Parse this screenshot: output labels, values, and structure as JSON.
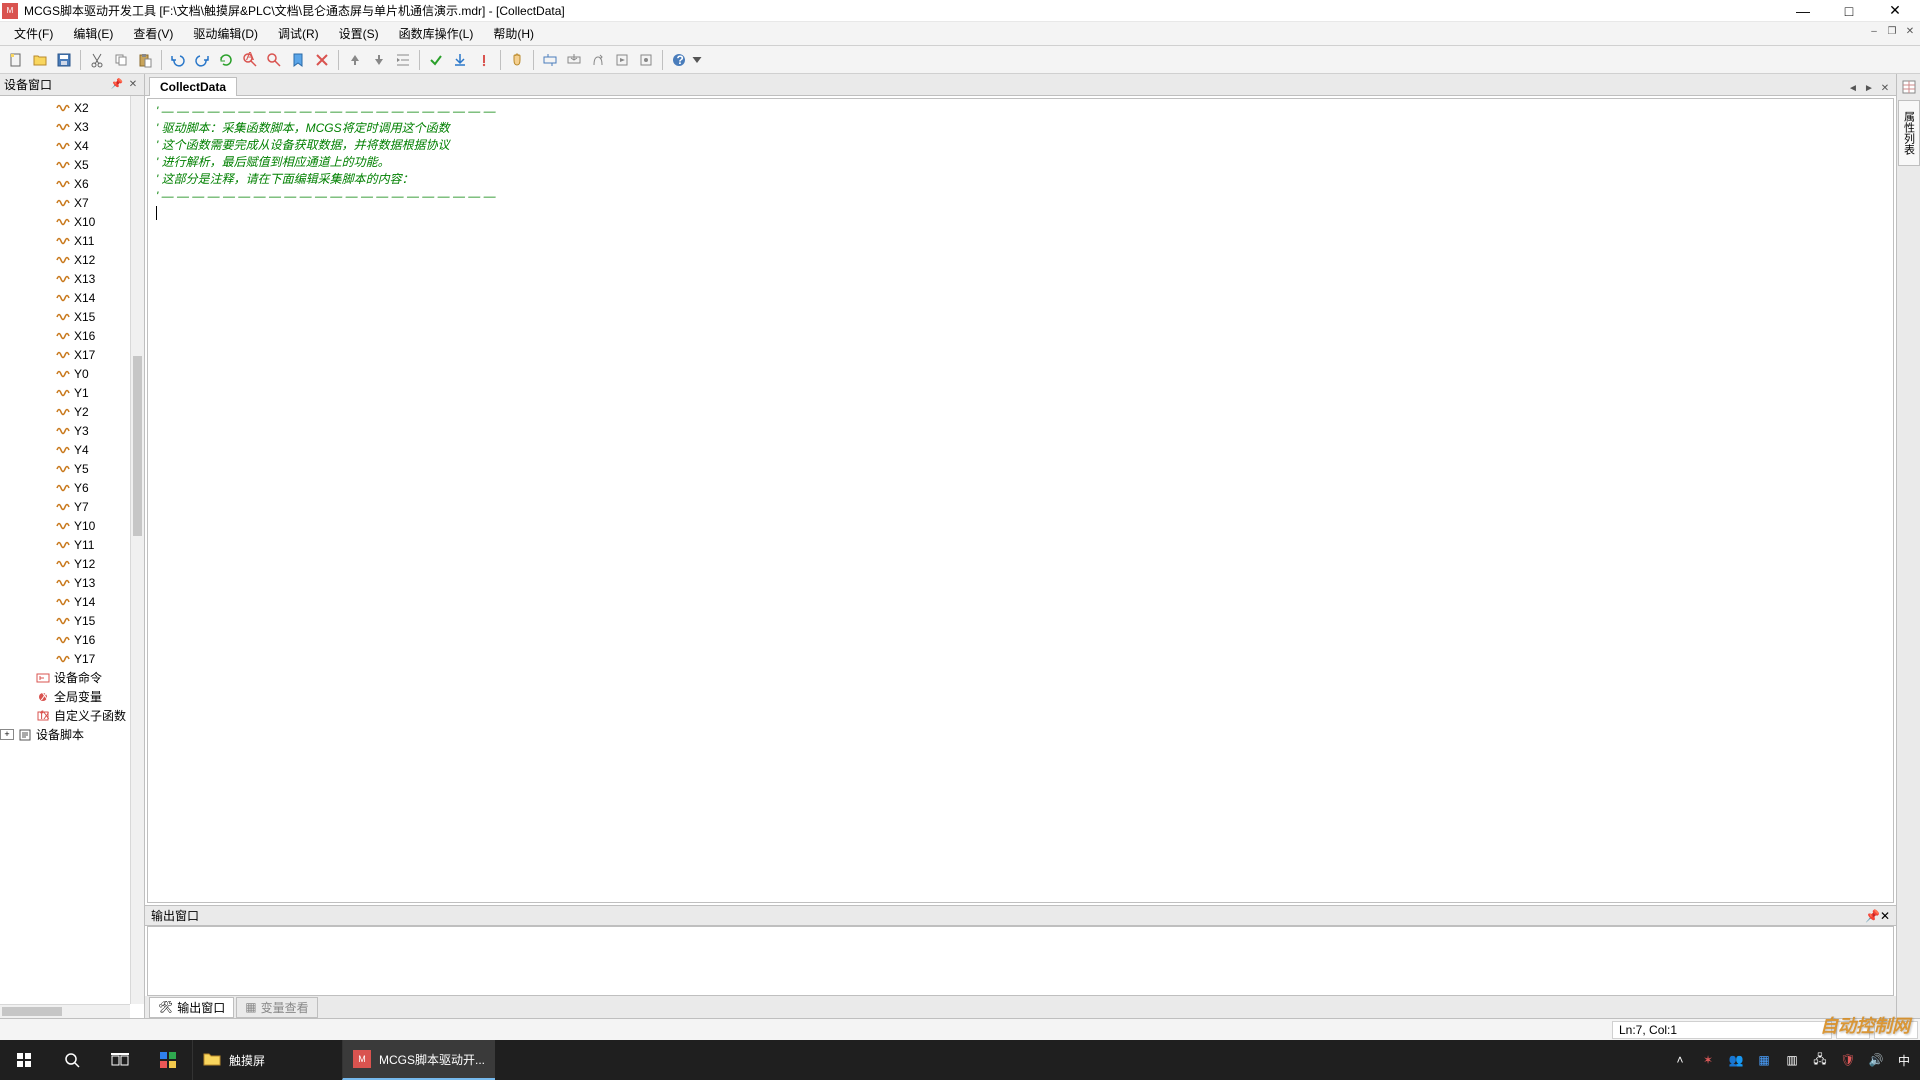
{
  "window": {
    "title": "MCGS脚本驱动开发工具 [F:\\文档\\触摸屏&PLC\\文档\\昆仑通态屏与单片机通信演示.mdr] - [CollectData]"
  },
  "menu": {
    "items": [
      "文件(F)",
      "编辑(E)",
      "查看(V)",
      "驱动编辑(D)",
      "调试(R)",
      "设置(S)",
      "函数库操作(L)",
      "帮助(H)"
    ]
  },
  "left_panel": {
    "title": "设备窗口",
    "nodes": [
      {
        "label": "X2",
        "icon": "s"
      },
      {
        "label": "X3",
        "icon": "s"
      },
      {
        "label": "X4",
        "icon": "s"
      },
      {
        "label": "X5",
        "icon": "s"
      },
      {
        "label": "X6",
        "icon": "s"
      },
      {
        "label": "X7",
        "icon": "s"
      },
      {
        "label": "X10",
        "icon": "s"
      },
      {
        "label": "X11",
        "icon": "s"
      },
      {
        "label": "X12",
        "icon": "s"
      },
      {
        "label": "X13",
        "icon": "s"
      },
      {
        "label": "X14",
        "icon": "s"
      },
      {
        "label": "X15",
        "icon": "s"
      },
      {
        "label": "X16",
        "icon": "s"
      },
      {
        "label": "X17",
        "icon": "s"
      },
      {
        "label": "Y0",
        "icon": "s"
      },
      {
        "label": "Y1",
        "icon": "s"
      },
      {
        "label": "Y2",
        "icon": "s"
      },
      {
        "label": "Y3",
        "icon": "s"
      },
      {
        "label": "Y4",
        "icon": "s"
      },
      {
        "label": "Y5",
        "icon": "s"
      },
      {
        "label": "Y6",
        "icon": "s"
      },
      {
        "label": "Y7",
        "icon": "s"
      },
      {
        "label": "Y10",
        "icon": "s"
      },
      {
        "label": "Y11",
        "icon": "s"
      },
      {
        "label": "Y12",
        "icon": "s"
      },
      {
        "label": "Y13",
        "icon": "s"
      },
      {
        "label": "Y14",
        "icon": "s"
      },
      {
        "label": "Y15",
        "icon": "s"
      },
      {
        "label": "Y16",
        "icon": "s"
      },
      {
        "label": "Y17",
        "icon": "s"
      }
    ],
    "footer_nodes": [
      {
        "label": "设备命令",
        "icon": "cmd"
      },
      {
        "label": "全局变量",
        "icon": "var"
      },
      {
        "label": "自定义子函数",
        "icon": "fn"
      },
      {
        "label": "设备脚本",
        "icon": "script",
        "expandable": true
      }
    ]
  },
  "editor": {
    "tab_label": "CollectData",
    "lines": [
      "' — — — — — — — — — — — — — — — — — — — — — —",
      "' 驱动脚本：采集函数脚本，MCGS将定时调用这个函数",
      "' 这个函数需要完成从设备获取数据，并将数据根据协议",
      "' 进行解析，最后赋值到相应通道上的功能。",
      "' 这部分是注释，请在下面编辑采集脚本的内容：",
      "' — — — — — — — — — — — — — — — — — — — — — —"
    ]
  },
  "output": {
    "title": "输出窗口",
    "tabs": [
      {
        "label": "输出窗口",
        "active": true
      },
      {
        "label": "变量查看",
        "active": false
      }
    ]
  },
  "right_panel": {
    "tab_label": "属性列表"
  },
  "status": {
    "cursor": "Ln:7, Col:1"
  },
  "taskbar": {
    "apps": [
      {
        "label": "触摸屏",
        "icon": "folder"
      },
      {
        "label": "MCGS脚本驱动开...",
        "icon": "mcgs",
        "active": true
      }
    ]
  },
  "watermark": "自动控制网"
}
